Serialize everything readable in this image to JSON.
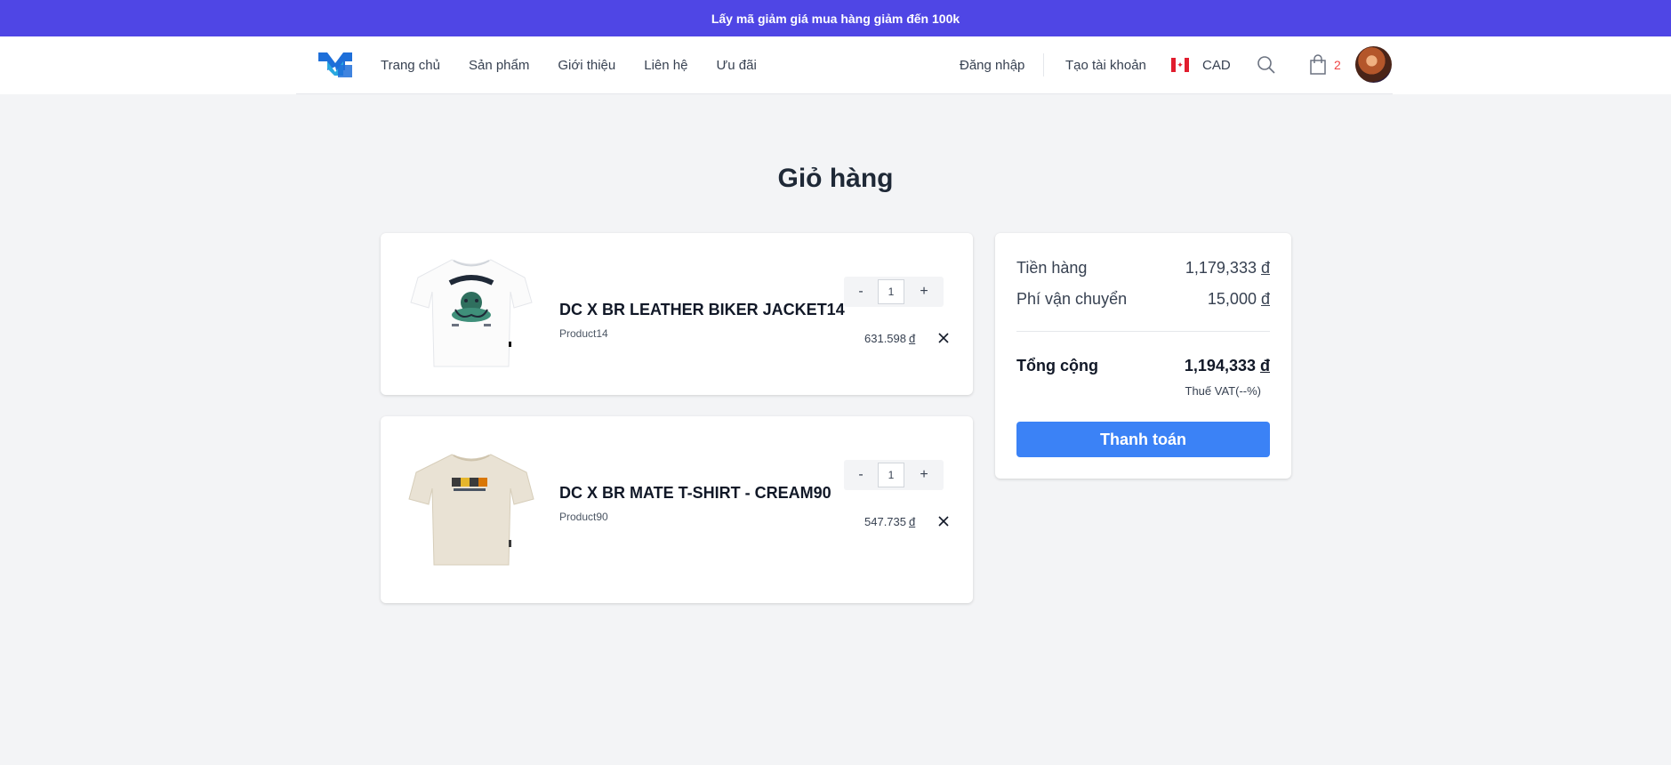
{
  "promo": {
    "text": "Lấy mã giảm giá mua hàng giảm đến 100k"
  },
  "nav": {
    "items": [
      "Trang chủ",
      "Sản phẩm",
      "Giới thiệu",
      "Liên hệ",
      "Ưu đãi"
    ]
  },
  "header": {
    "login": "Đăng nhập",
    "signup": "Tạo tài khoản",
    "currency": "CAD",
    "cart_count": "2"
  },
  "page": {
    "title": "Giỏ hàng"
  },
  "cart": {
    "items": [
      {
        "name": "DC X BR LEATHER BIKER JACKET14",
        "sku": "Product14",
        "quantity": "1",
        "price": "631.598",
        "currency_symbol": "đ",
        "image": "white-tshirt"
      },
      {
        "name": "DC X BR MATE T-SHIRT - CREAM90",
        "sku": "Product90",
        "quantity": "1",
        "price": "547.735",
        "currency_symbol": "đ",
        "image": "cream-tshirt"
      }
    ],
    "minus": "-",
    "plus": "+"
  },
  "summary": {
    "subtotal_label": "Tiền hàng",
    "subtotal_value": "1,179,333",
    "shipping_label": "Phí vận chuyển",
    "shipping_value": "15,000",
    "total_label": "Tổng cộng",
    "total_value": "1,194,333",
    "currency_symbol": "đ",
    "vat": "Thuế VAT(--%)",
    "checkout": "Thanh toán"
  },
  "colors": {
    "accent": "#4f46e5",
    "button": "#3b82f6",
    "cart_badge": "#ef4444"
  }
}
